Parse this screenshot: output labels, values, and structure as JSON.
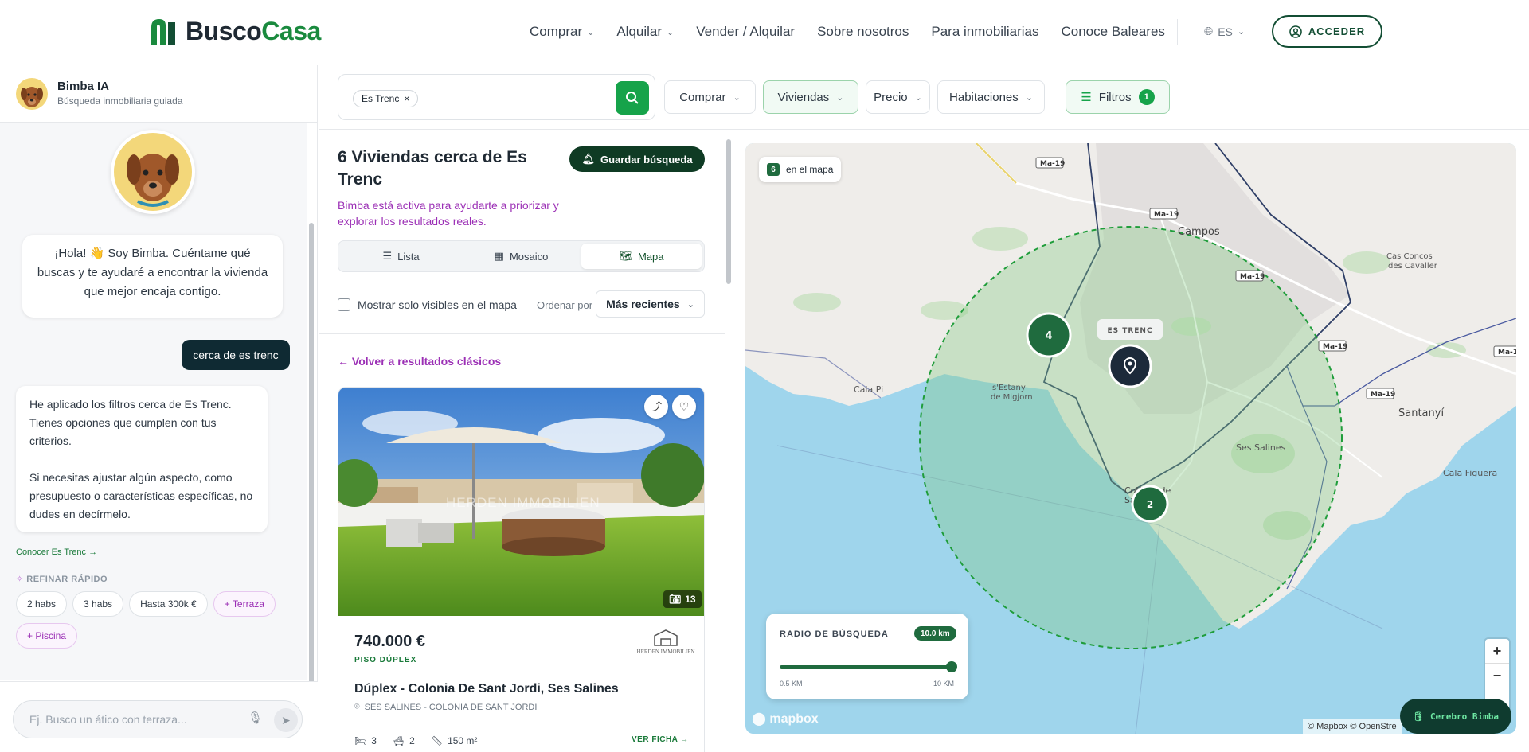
{
  "header": {
    "logo": {
      "part1": "Busco",
      "part2": "Casa"
    },
    "nav": [
      {
        "label": "Comprar",
        "dropdown": true
      },
      {
        "label": "Alquilar",
        "dropdown": true
      },
      {
        "label": "Vender / Alquilar",
        "dropdown": false
      },
      {
        "label": "Sobre nosotros",
        "dropdown": false
      },
      {
        "label": "Para inmobiliarias",
        "dropdown": false
      },
      {
        "label": "Conoce Baleares",
        "dropdown": false
      }
    ],
    "lang": "ES",
    "login": "ACCEDER"
  },
  "chat": {
    "name": "Bimba IA",
    "subtitle": "Búsqueda inmobiliaria guiada",
    "greeting": "¡Hola! 👋 Soy Bimba. Cuéntame qué buscas y te ayudaré a encontrar la vivienda que mejor encaja contigo.",
    "user_msg": "cerca de es trenc",
    "reply_p1": "He aplicado los filtros cerca de Es Trenc. Tienes opciones que cumplen con tus criterios.",
    "reply_p2": "Si necesitas ajustar algún aspecto, como presupuesto o características específicas, no dudes en decírmelo.",
    "know_link": "Conocer Es Trenc →",
    "refine_label": "REFINAR RÁPIDO",
    "chips": [
      {
        "label": "2 habs",
        "accent": false
      },
      {
        "label": "3 habs",
        "accent": false
      },
      {
        "label": "Hasta 300k €",
        "accent": false
      },
      {
        "label": "+ Terraza",
        "accent": true
      },
      {
        "label": "+ Piscina",
        "accent": true
      }
    ],
    "input_placeholder": "Ej. Busco un ático con terraza..."
  },
  "search": {
    "tag": "Es Trenc",
    "filters": {
      "comprar": "Comprar",
      "viviendas": "Viviendas",
      "precio": "Precio",
      "habitaciones": "Habitaciones",
      "filtros": "Filtros",
      "filtros_count": "1"
    }
  },
  "results": {
    "title": "6 Viviendas cerca de Es Trenc",
    "subtitle": "Bimba está activa para ayudarte a priorizar y explorar los resultados reales.",
    "save_label": "Guardar búsqueda",
    "views": {
      "list": "Lista",
      "mosaic": "Mosaico",
      "map": "Mapa",
      "active": "map"
    },
    "visible_only": "Mostrar solo visibles en el mapa",
    "order_label": "Ordenar por",
    "order_value": "Más recientes",
    "back_link": "← Volver a resultados clásicos"
  },
  "listing": {
    "photo_count": "13",
    "watermark": "HERDEN IMMOBILIEN",
    "price": "740.000 €",
    "type": "PISO DÚPLEX",
    "agency": "HERDEN IMMOBILIEN",
    "name": "Dúplex - Colonia De Sant Jordi, Ses Salines",
    "location": "SES SALINES - COLONIA DE SANT JORDI",
    "beds": "3",
    "baths": "2",
    "area": "150 m²",
    "cta": "VER FICHA →"
  },
  "map": {
    "count": "6",
    "count_label": "en el mapa",
    "places": [
      "Campos",
      "Cas Concos des Cavaller",
      "Cala Pi",
      "s'Estany de Migjorn",
      "Santanyí",
      "Ses Salines",
      "Cala Figuera",
      "Colònia de Sant Jordi"
    ],
    "roads": [
      "Ma-19"
    ],
    "pin_label": "ES TRENC",
    "clusters": [
      "4",
      "2"
    ],
    "radius_label": "RADIO DE BÚSQUEDA",
    "radius_value": "10.0 km",
    "radius_fraction": 1.0,
    "radius_min": "0.5 KM",
    "radius_max": "10 KM",
    "brand": "mapbox",
    "attribution": "© Mapbox © OpenStre",
    "zoom_in": "+",
    "zoom_out": "−",
    "compass": "▲"
  },
  "cerebro": "Cerebro Bimba",
  "colors": {
    "brand_green": "#1a8a3e",
    "dark_green": "#134e34",
    "purple": "#9b2fb5",
    "sea": "#9fd5ec"
  }
}
